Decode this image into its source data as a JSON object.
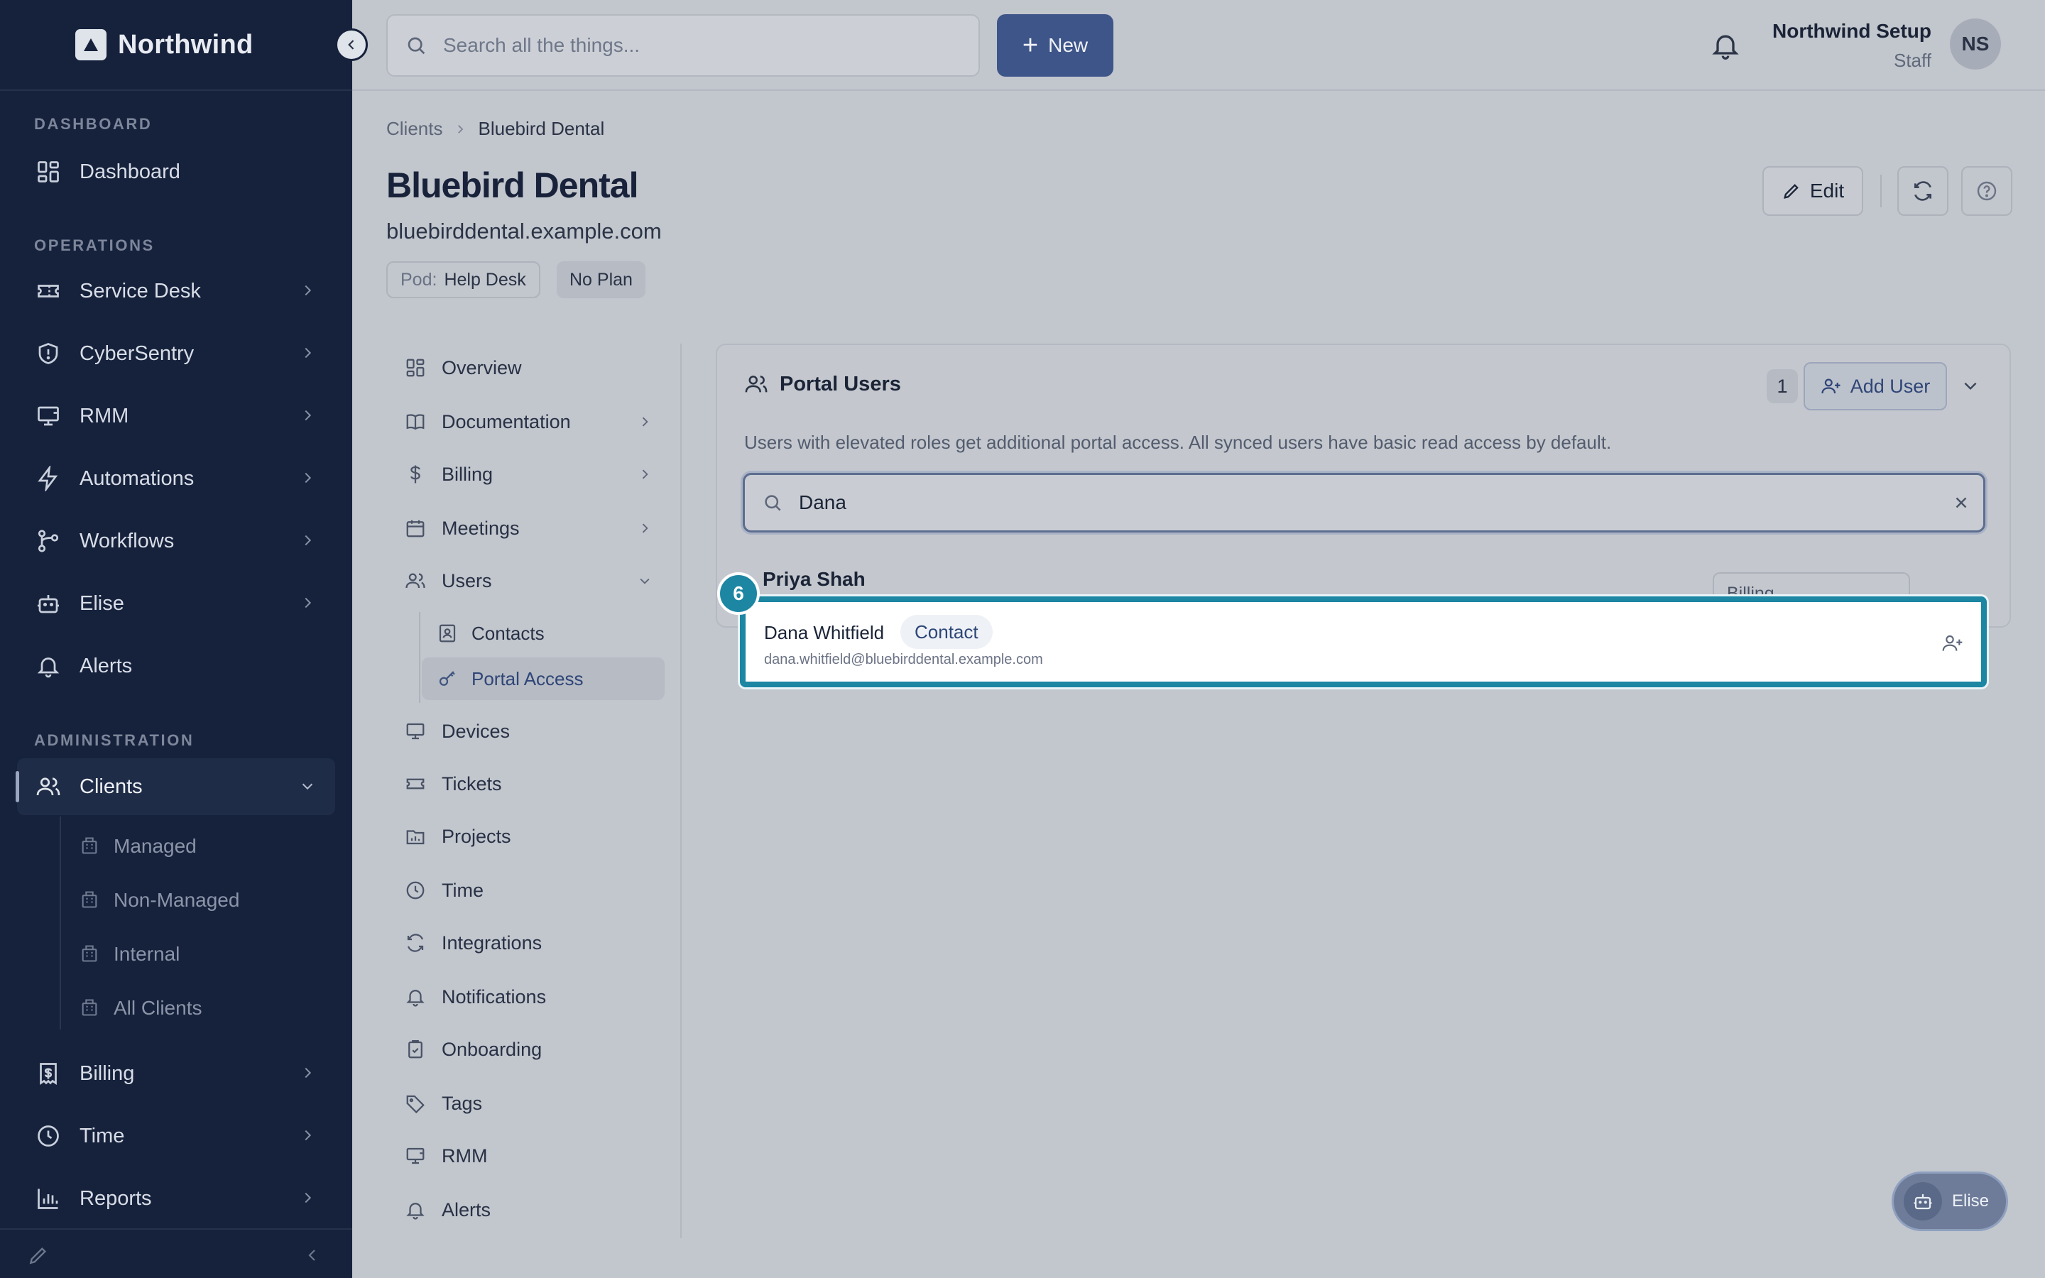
{
  "app": {
    "brand": "Northwind"
  },
  "topbar": {
    "search_placeholder": "Search all the things...",
    "new_label": "New",
    "user_name": "Northwind Setup",
    "user_role": "Staff",
    "avatar_initials": "NS"
  },
  "sidebar": {
    "sections": {
      "dashboard": "DASHBOARD",
      "operations": "OPERATIONS",
      "administration": "ADMINISTRATION"
    },
    "items": {
      "dashboard": "Dashboard",
      "service_desk": "Service Desk",
      "cybersentry": "CyberSentry",
      "rmm": "RMM",
      "automations": "Automations",
      "workflows": "Workflows",
      "elise": "Elise",
      "alerts": "Alerts",
      "clients": "Clients",
      "billing": "Billing",
      "time": "Time",
      "reports": "Reports"
    },
    "client_subitems": {
      "managed": "Managed",
      "non_managed": "Non-Managed",
      "internal": "Internal",
      "all": "All Clients"
    }
  },
  "breadcrumb": {
    "root": "Clients",
    "current": "Bluebird Dental"
  },
  "client": {
    "name": "Bluebird Dental",
    "domain": "bluebirddental.example.com",
    "pod_key": "Pod:",
    "pod_value": "Help Desk",
    "plan": "No Plan",
    "edit_label": "Edit"
  },
  "subnav": {
    "overview": "Overview",
    "documentation": "Documentation",
    "billing": "Billing",
    "meetings": "Meetings",
    "users": "Users",
    "contacts": "Contacts",
    "portal_access": "Portal Access",
    "devices": "Devices",
    "tickets": "Tickets",
    "projects": "Projects",
    "time": "Time",
    "integrations": "Integrations",
    "notifications": "Notifications",
    "onboarding": "Onboarding",
    "tags": "Tags",
    "rmm": "RMM",
    "alerts": "Alerts"
  },
  "portal_users": {
    "title": "Portal Users",
    "count": "1",
    "add_user_label": "Add User",
    "description": "Users with elevated roles get additional portal access. All synced users have basic read access by default.",
    "search_value": "Dana",
    "existing_user": "Priya Shah",
    "existing_role": "Billing",
    "result": {
      "name": "Dana Whitfield",
      "tag": "Contact",
      "email": "dana.whitfield@bluebirddental.example.com"
    },
    "tour_step": "6"
  },
  "assistant": {
    "label": "Elise"
  },
  "colors": {
    "sidebar": "#16223c",
    "accent": "#3e5589",
    "spotlight": "#1c86a3"
  }
}
